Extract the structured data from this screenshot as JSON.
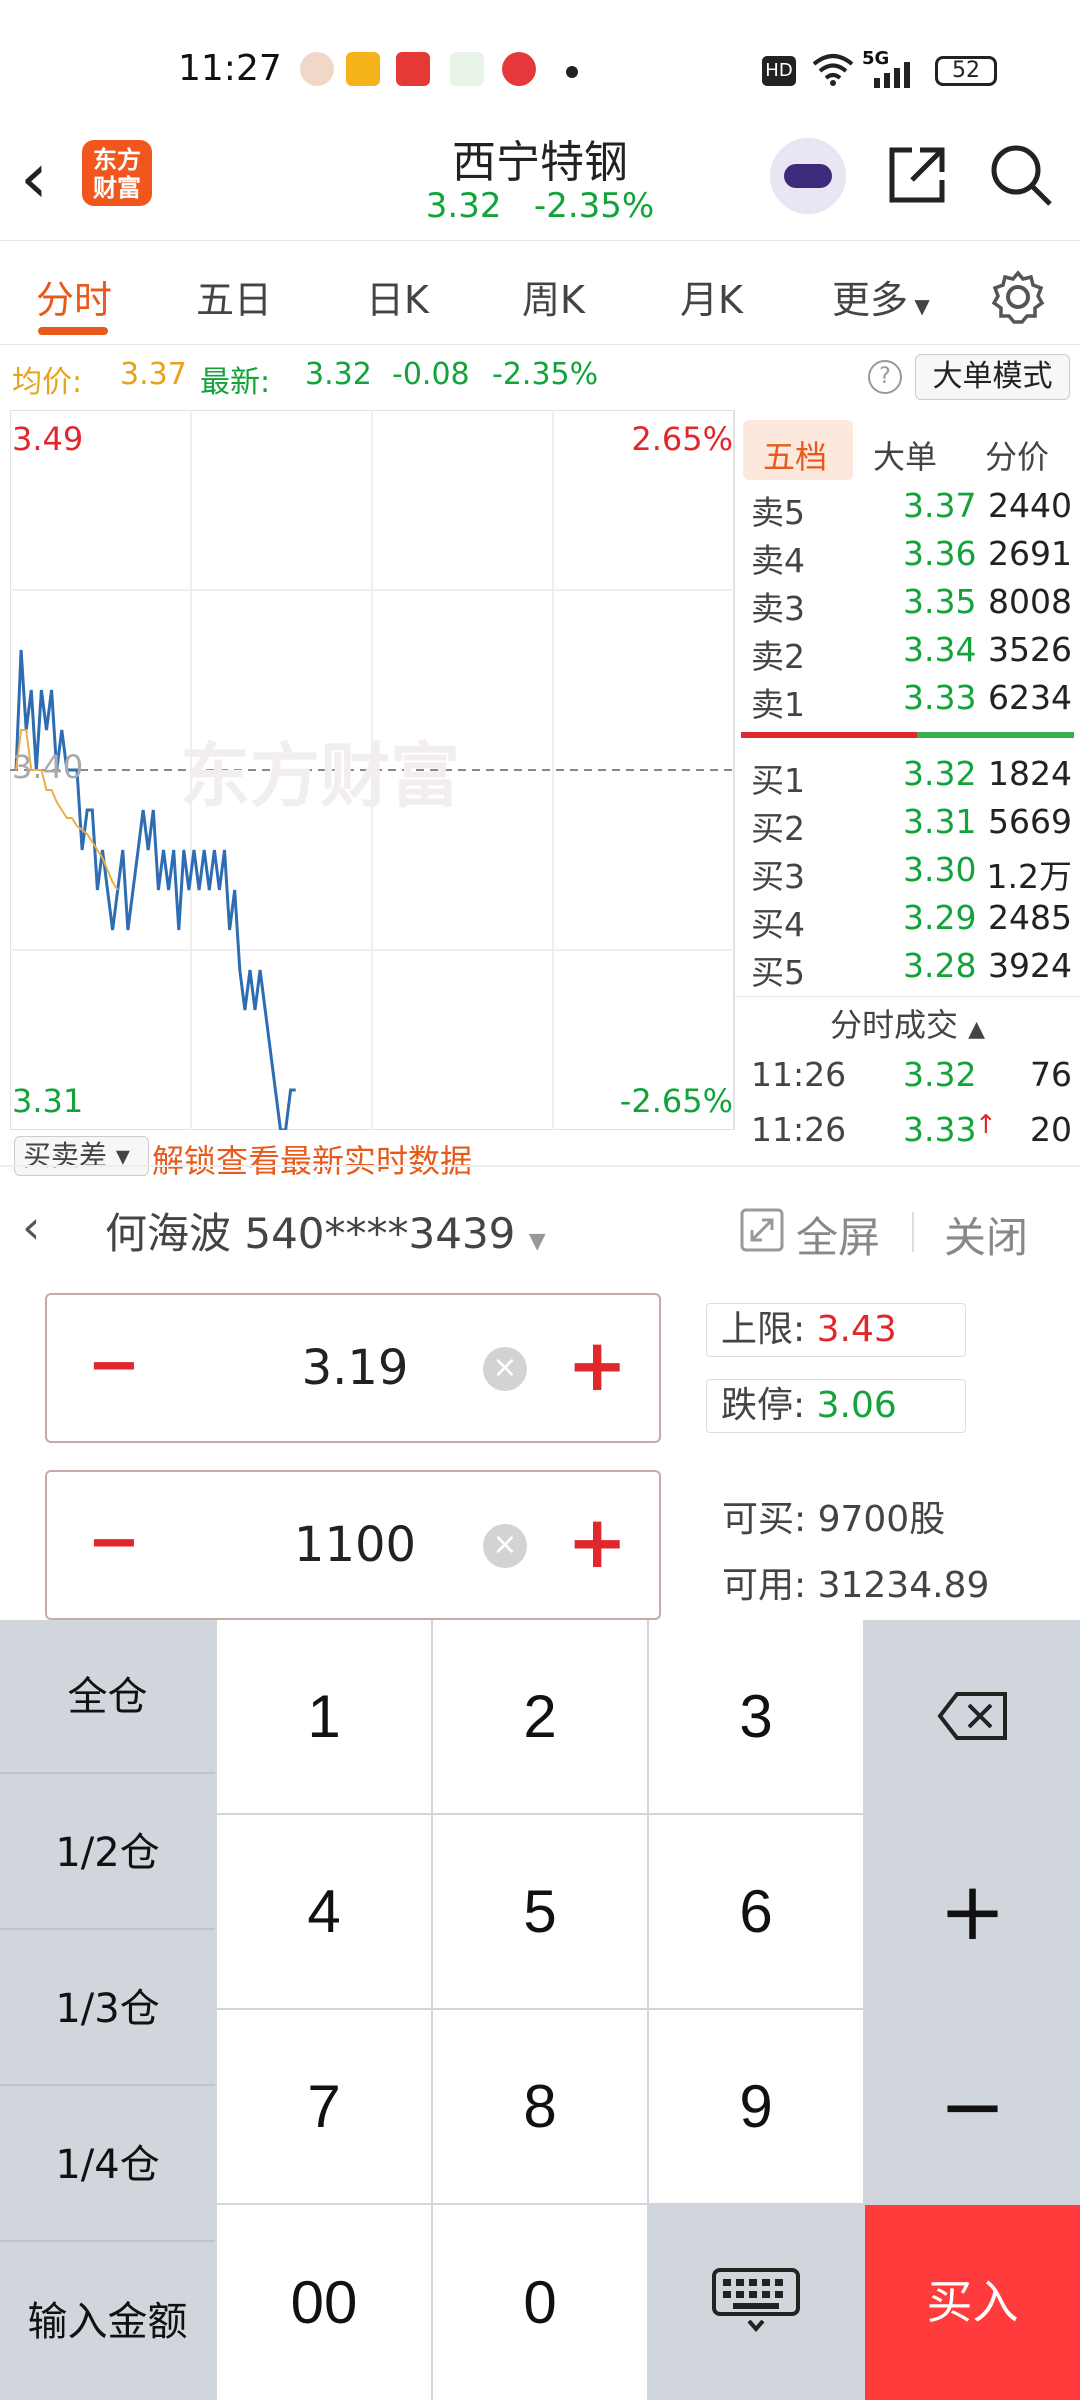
{
  "status_bar": {
    "time": "11:27",
    "battery": "52",
    "network": "5G",
    "hd": "HD"
  },
  "header": {
    "logo_line1": "东方",
    "logo_line2": "财富",
    "title": "西宁特钢",
    "price": "3.32",
    "change_pct": "-2.35%"
  },
  "tabs": [
    "分时",
    "五日",
    "日K",
    "周K",
    "月K",
    "更多"
  ],
  "active_tab": "分时",
  "info": {
    "avg_label": "均价:",
    "avg_value": "3.37",
    "latest_label": "最新:",
    "latest_value": "3.32",
    "change": "-0.08",
    "change_pct": "-2.35%",
    "mode_button": "大单模式"
  },
  "chart_data": {
    "type": "line",
    "y_max": "3.49",
    "y_mid": "3.40",
    "y_min": "3.31",
    "pct_max": "2.65%",
    "pct_min": "-2.65%",
    "ylim": [
      3.31,
      3.49
    ],
    "watermark": "东方财富",
    "series": [
      {
        "values": [
          3.4,
          3.43,
          3.41,
          3.42,
          3.4,
          3.42,
          3.41,
          3.42,
          3.4,
          3.41,
          3.4,
          3.4,
          3.4,
          3.38,
          3.39,
          3.39,
          3.37,
          3.38,
          3.37,
          3.36,
          3.37,
          3.38,
          3.36,
          3.37,
          3.38,
          3.39,
          3.38,
          3.39,
          3.37,
          3.38,
          3.37,
          3.38,
          3.36,
          3.38,
          3.37,
          3.38,
          3.37,
          3.38,
          3.37,
          3.38,
          3.37,
          3.38,
          3.36,
          3.37,
          3.35,
          3.34,
          3.35,
          3.34,
          3.35,
          3.34,
          3.33,
          3.32,
          3.31,
          3.31,
          3.32,
          3.32
        ]
      },
      {
        "values": [
          3.4,
          3.41,
          3.41,
          3.4,
          3.4,
          3.4,
          3.395,
          3.395,
          3.392,
          3.39,
          3.388,
          3.388,
          3.386,
          3.385,
          3.384,
          3.382,
          3.38,
          3.378,
          3.375,
          3.372,
          3.37
        ]
      }
    ],
    "bottom_left": "买卖差",
    "bottom_link": "解锁查看最新实时数据"
  },
  "order_book": {
    "tabs": [
      "五档",
      "大单",
      "分价"
    ],
    "asks": [
      {
        "label": "卖5",
        "price": "3.37",
        "vol": "2440"
      },
      {
        "label": "卖4",
        "price": "3.36",
        "vol": "2691"
      },
      {
        "label": "卖3",
        "price": "3.35",
        "vol": "8008"
      },
      {
        "label": "卖2",
        "price": "3.34",
        "vol": "3526"
      },
      {
        "label": "卖1",
        "price": "3.33",
        "vol": "6234"
      }
    ],
    "bids": [
      {
        "label": "买1",
        "price": "3.32",
        "vol": "1824"
      },
      {
        "label": "买2",
        "price": "3.31",
        "vol": "5669"
      },
      {
        "label": "买3",
        "price": "3.30",
        "vol": "1.2万"
      },
      {
        "label": "买4",
        "price": "3.29",
        "vol": "2485"
      },
      {
        "label": "买5",
        "price": "3.28",
        "vol": "3924"
      }
    ],
    "trades_title": "分时成交",
    "trades": [
      {
        "time": "11:26",
        "price": "3.32",
        "vol": "76"
      },
      {
        "time": "11:26",
        "price": "3.33",
        "vol": "20"
      }
    ]
  },
  "trade": {
    "account": "何海波 540****3439",
    "fullscreen": "全屏",
    "close": "关闭",
    "price_value": "3.19",
    "qty_value": "1100",
    "upper_label": "上限:",
    "upper_value": "3.43",
    "lower_label": "跌停:",
    "lower_value": "3.06",
    "can_buy_label": "可买:",
    "can_buy_value": "9700股",
    "available_label": "可用:",
    "available_value": "31234.89"
  },
  "keypad": {
    "side": [
      "全仓",
      "1/2仓",
      "1/3仓",
      "1/4仓",
      "输入金额"
    ],
    "digits": [
      "1",
      "2",
      "3",
      "4",
      "5",
      "6",
      "7",
      "8",
      "9",
      "00",
      "0"
    ],
    "buy": "买入"
  }
}
